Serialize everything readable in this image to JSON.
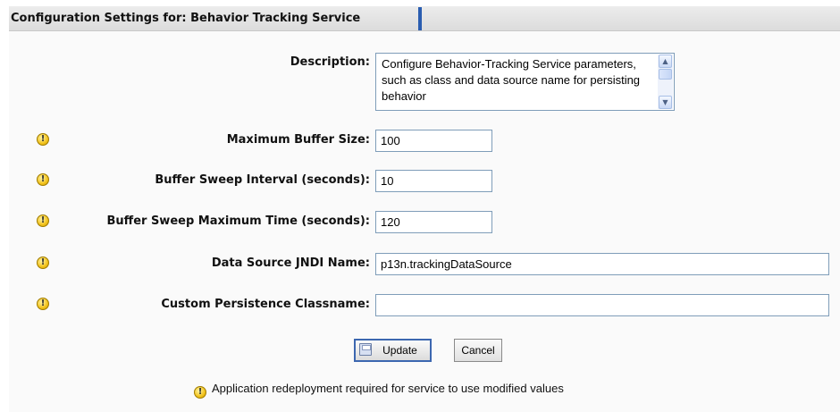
{
  "header": {
    "title": "Configuration Settings for: Behavior Tracking Service"
  },
  "form": {
    "description_label": "Description:",
    "description_value": "Configure Behavior-Tracking Service parameters, such as class and data source name for persisting behavior",
    "fields": [
      {
        "label": "Maximum Buffer Size:",
        "value": "100"
      },
      {
        "label": "Buffer Sweep Interval (seconds):",
        "value": "10"
      },
      {
        "label": "Buffer Sweep Maximum Time (seconds):",
        "value": "120"
      },
      {
        "label": "Data Source JNDI Name:",
        "value": "p13n.trackingDataSource"
      },
      {
        "label": "Custom Persistence Classname:",
        "value": ""
      }
    ]
  },
  "buttons": {
    "update": "Update",
    "cancel": "Cancel"
  },
  "footer": {
    "note": "Application redeployment required for service to use modified values"
  },
  "icons": {
    "warning": "warning-icon",
    "save": "save-icon"
  },
  "colors": {
    "accent": "#2a5db0",
    "warning": "#f2c21b"
  }
}
